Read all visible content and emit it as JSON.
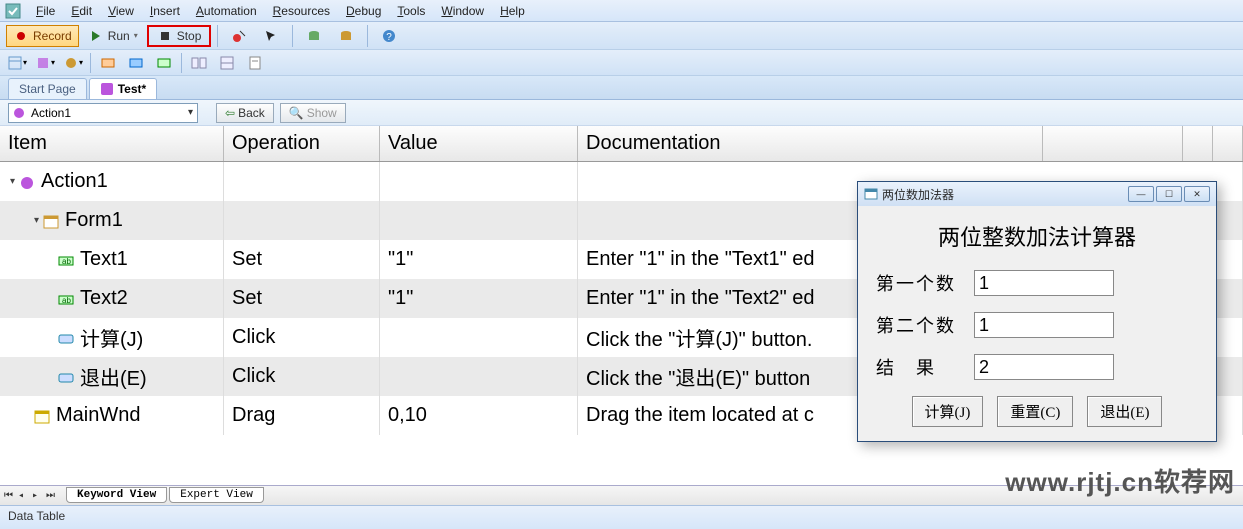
{
  "menu": [
    "File",
    "Edit",
    "View",
    "Insert",
    "Automation",
    "Resources",
    "Debug",
    "Tools",
    "Window",
    "Help"
  ],
  "toolbar": {
    "record": "Record",
    "run": "Run",
    "stop": "Stop"
  },
  "tabs": {
    "start": "Start Page",
    "test": "Test*"
  },
  "action_bar": {
    "action": "Action1",
    "back": "Back",
    "show": "Show"
  },
  "grid": {
    "headers": {
      "item": "Item",
      "operation": "Operation",
      "value": "Value",
      "doc": "Documentation"
    },
    "rows": [
      {
        "indent": 0,
        "icon": "action",
        "item": "Action1",
        "op": "",
        "val": "",
        "doc": "",
        "alt": false,
        "toggle": true
      },
      {
        "indent": 1,
        "icon": "form",
        "item": "Form1",
        "op": "",
        "val": "",
        "doc": "",
        "alt": true,
        "toggle": true
      },
      {
        "indent": 2,
        "icon": "text",
        "item": "Text1",
        "op": "Set",
        "val": "\"1\"",
        "doc": "Enter \"1\" in the \"Text1\" ed",
        "alt": false
      },
      {
        "indent": 2,
        "icon": "text",
        "item": "Text2",
        "op": "Set",
        "val": "\"1\"",
        "doc": "Enter \"1\" in the \"Text2\" ed",
        "alt": true
      },
      {
        "indent": 2,
        "icon": "button",
        "item": "计算(J)",
        "op": "Click",
        "val": "",
        "doc": "Click the \"计算(J)\" button.",
        "alt": false
      },
      {
        "indent": 2,
        "icon": "button",
        "item": "退出(E)",
        "op": "Click",
        "val": "",
        "doc": "Click the \"退出(E)\" button",
        "alt": true
      },
      {
        "indent": 1,
        "icon": "window",
        "item": "MainWnd",
        "op": "Drag",
        "val": "0,10",
        "doc": "Drag the item located at c",
        "alt": false
      }
    ]
  },
  "view_tabs": {
    "keyword": "Keyword View",
    "expert": "Expert View"
  },
  "data_table": "Data Table",
  "popup": {
    "title": "两位数加法器",
    "heading": "两位整数加法计算器",
    "label1": "第一个数",
    "label2": "第二个数",
    "label3": "结　果",
    "val1": "1",
    "val2": "1",
    "val3": "2",
    "btn_calc": "计算(J)",
    "btn_reset": "重置(C)",
    "btn_exit": "退出(E)"
  },
  "watermark": "www.rjtj.cn软荐网"
}
